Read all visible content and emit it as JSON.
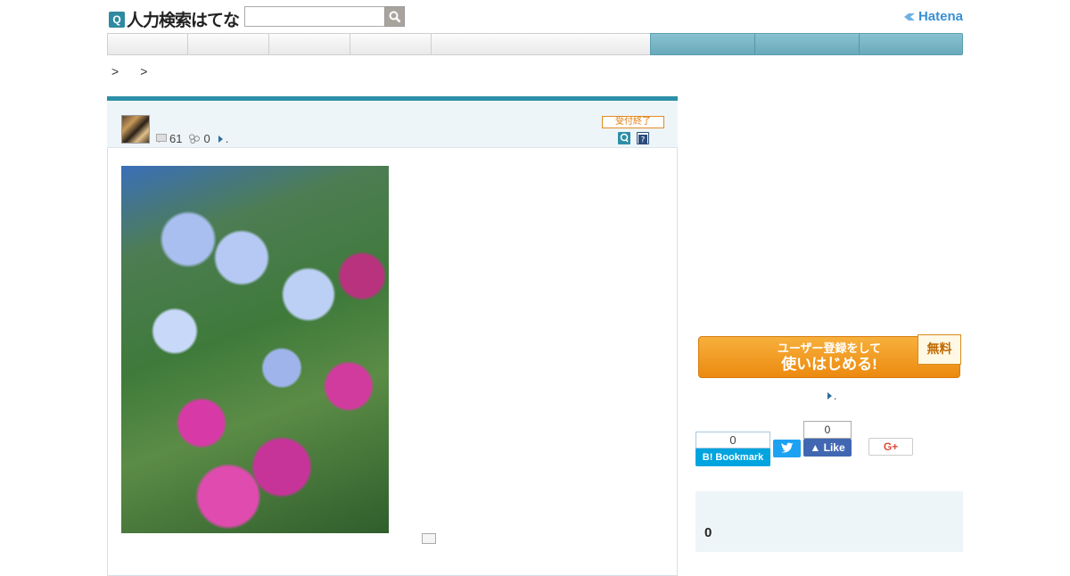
{
  "header": {
    "logo_text": "人力検索はてな",
    "brand": "Hatena",
    "search": {
      "value": "",
      "placeholder": ""
    }
  },
  "breadcrumb": {
    "items": [
      "",
      ""
    ],
    "separators": [
      ">",
      ">"
    ]
  },
  "question": {
    "points": "61",
    "bookmarks": "0",
    "status_badge": "受付終了",
    "meta_tail": "."
  },
  "sidebar": {
    "signup_line1": "ユーザー登録をして",
    "signup_line2": "使いはじめる!",
    "free_tag": "無料",
    "link_tail": ".",
    "share": {
      "hatena_count": "0",
      "hatena_label": "B! Bookmark",
      "facebook_count": "0",
      "facebook_label": "Like",
      "gplus_label": "G+"
    },
    "count_value": "0"
  },
  "colors": {
    "accent": "#2e8fa8",
    "nav_active": "#76b4c5",
    "signup": "#ef9421",
    "hatena_blue": "#00a4de",
    "twitter": "#1da1f2",
    "facebook": "#4267b2"
  }
}
